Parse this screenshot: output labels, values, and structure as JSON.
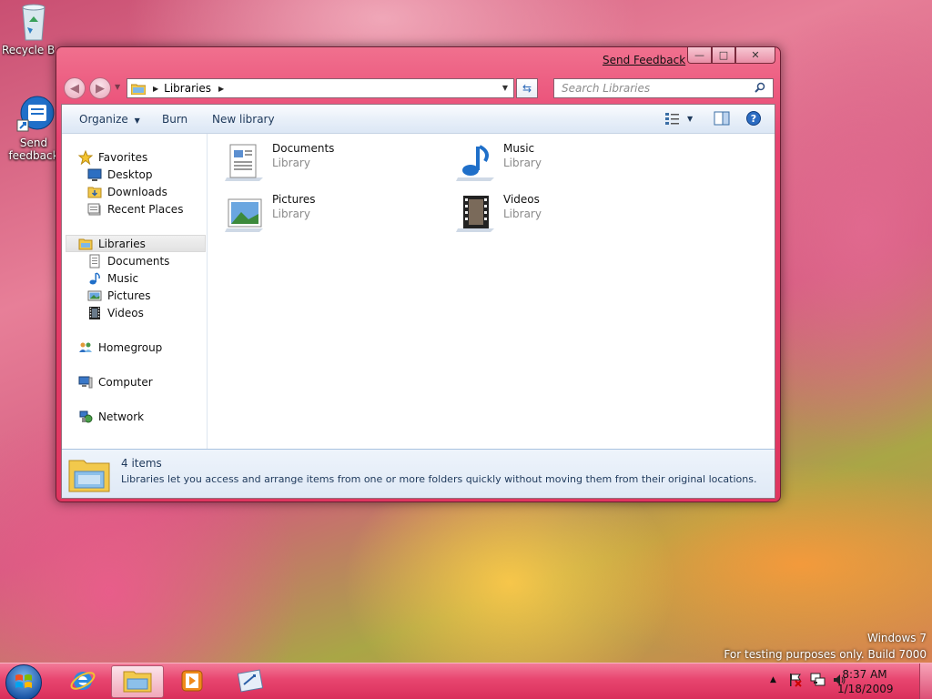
{
  "desktop": {
    "icons": [
      {
        "label": "Recycle Bin",
        "icon": "recycle-bin-icon"
      },
      {
        "label": "Send feedback",
        "icon": "send-feedback-icon"
      }
    ]
  },
  "window": {
    "feedback_link": "Send Feedback",
    "caption_buttons": {
      "minimize": "—",
      "maximize": "□",
      "close": "✕"
    },
    "nav": {
      "back": "◀",
      "forward": "▶",
      "history_dropdown": "▼"
    },
    "address": {
      "crumb": "Libraries",
      "crumb_arrow": "▶",
      "dropdown": "▼"
    },
    "refresh": "⇆",
    "search": {
      "placeholder": "Search Libraries",
      "icon": "🔍"
    },
    "toolbar": {
      "organize": "Organize",
      "organize_arrow": "▼",
      "burn": "Burn",
      "new_library": "New library",
      "views_arrow": "▼",
      "help": "?"
    },
    "navpane": {
      "favorites": "Favorites",
      "desktop": "Desktop",
      "downloads": "Downloads",
      "recent_places": "Recent Places",
      "libraries": "Libraries",
      "documents": "Documents",
      "music": "Music",
      "pictures": "Pictures",
      "videos": "Videos",
      "homegroup": "Homegroup",
      "computer": "Computer",
      "network": "Network"
    },
    "libraries": [
      {
        "name": "Documents",
        "type": "Library"
      },
      {
        "name": "Music",
        "type": "Library"
      },
      {
        "name": "Pictures",
        "type": "Library"
      },
      {
        "name": "Videos",
        "type": "Library"
      }
    ],
    "details": {
      "count": "4 items",
      "description": "Libraries let you access and arrange items from one or more folders quickly without moving them from their original locations."
    }
  },
  "watermark": {
    "line1": "Windows 7",
    "line2": "For testing purposes only. Build 7000"
  },
  "taskbar": {
    "tray_arrow": "▲",
    "clock_time": "8:37 AM",
    "clock_date": "1/18/2009"
  }
}
